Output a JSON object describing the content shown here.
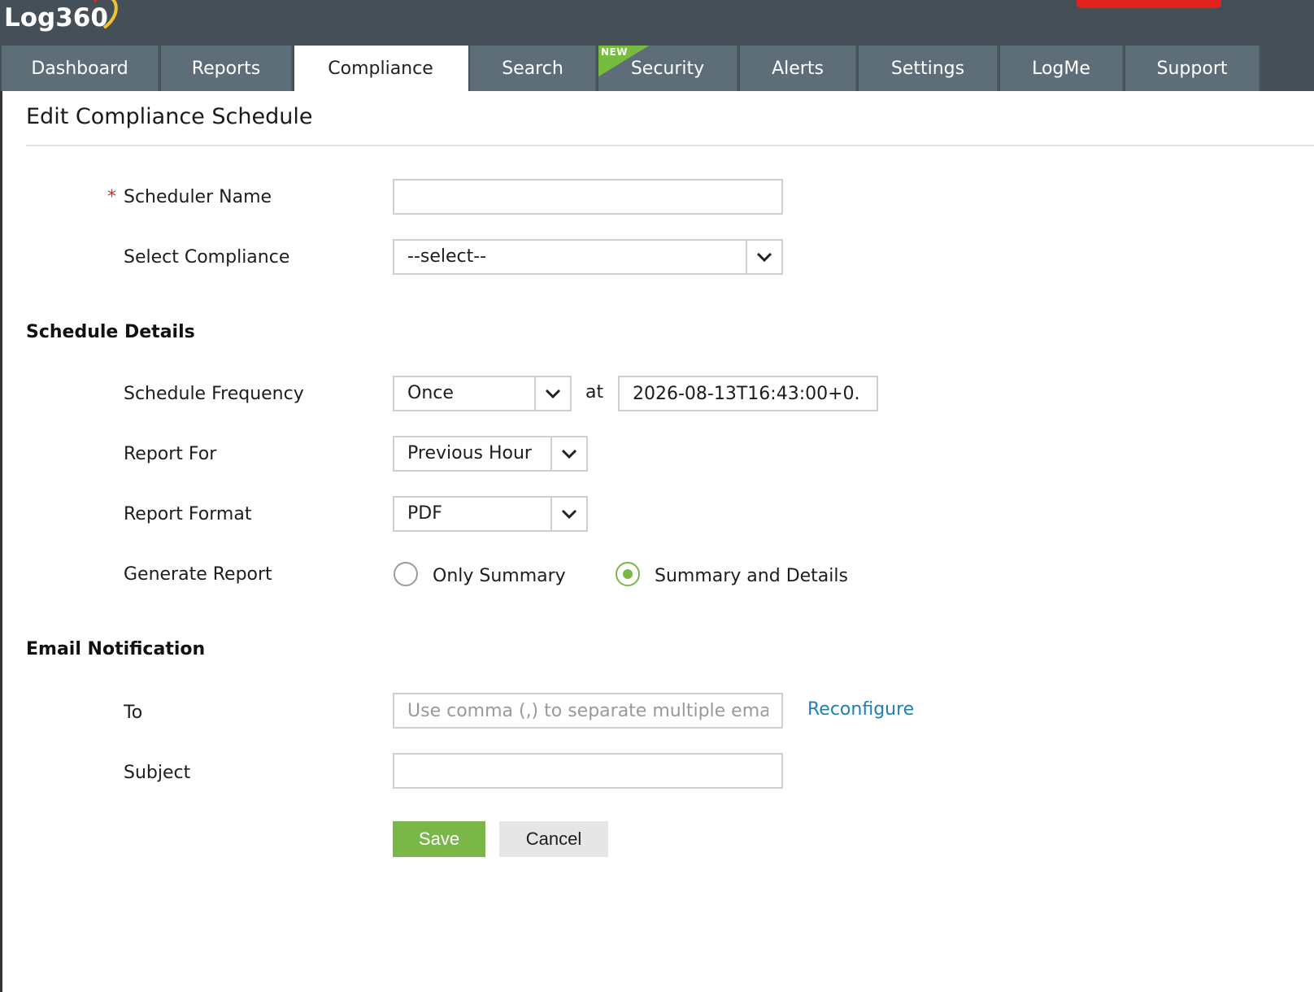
{
  "app": {
    "logo_text": "Log360"
  },
  "nav": {
    "tabs": [
      {
        "label": "Dashboard"
      },
      {
        "label": "Reports"
      },
      {
        "label": "Compliance"
      },
      {
        "label": "Search"
      },
      {
        "label": "Security",
        "badge": "NEW"
      },
      {
        "label": "Alerts"
      },
      {
        "label": "Settings"
      },
      {
        "label": "LogMe"
      },
      {
        "label": "Support"
      }
    ],
    "active_tab": "Compliance"
  },
  "page": {
    "title": "Edit Compliance Schedule"
  },
  "form": {
    "required_marker": "*",
    "scheduler_name": {
      "label": "Scheduler Name",
      "value": ""
    },
    "select_compliance": {
      "label": "Select Compliance",
      "value": "--select--"
    },
    "schedule_details_heading": "Schedule Details",
    "schedule_frequency": {
      "label": "Schedule Frequency",
      "value": "Once",
      "at_label": "at",
      "datetime": "2026-08-13T16:43:00+0."
    },
    "report_for": {
      "label": "Report For",
      "value": "Previous Hour"
    },
    "report_format": {
      "label": "Report Format",
      "value": "PDF"
    },
    "generate_report": {
      "label": "Generate Report",
      "options": [
        "Only Summary",
        "Summary and Details"
      ],
      "selected": "Summary and Details"
    },
    "email_heading": "Email Notification",
    "to": {
      "label": "To",
      "value": "",
      "placeholder": "Use comma (,) to separate multiple ema",
      "link": "Reconfigure"
    },
    "subject": {
      "label": "Subject",
      "value": ""
    },
    "save_label": "Save",
    "cancel_label": "Cancel"
  },
  "colors": {
    "header_bg": "#444f58",
    "tab_bg": "#5d6e79",
    "accent_green": "#7ab648",
    "link_blue": "#1f7fb2",
    "brand_red": "#e2231a"
  }
}
